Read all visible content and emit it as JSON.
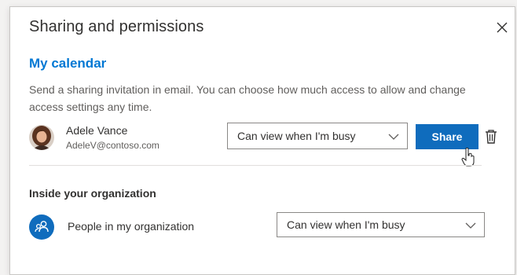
{
  "dialog": {
    "title": "Sharing and permissions",
    "close_icon": "close-icon"
  },
  "calendar": {
    "heading": "My calendar",
    "description": "Send a sharing invitation in email. You can choose how much access to allow and change access settings any time."
  },
  "person": {
    "name": "Adele Vance",
    "email": "AdeleV@contoso.com",
    "permission": "Can view when I'm busy",
    "share_label": "Share",
    "delete_icon": "trash-icon"
  },
  "organization": {
    "heading": "Inside your organization",
    "label": "People in my organization",
    "permission": "Can view when I'm busy",
    "icon": "people-icon"
  },
  "colors": {
    "accent": "#0f6cbd",
    "heading_blue": "#0078d4"
  }
}
